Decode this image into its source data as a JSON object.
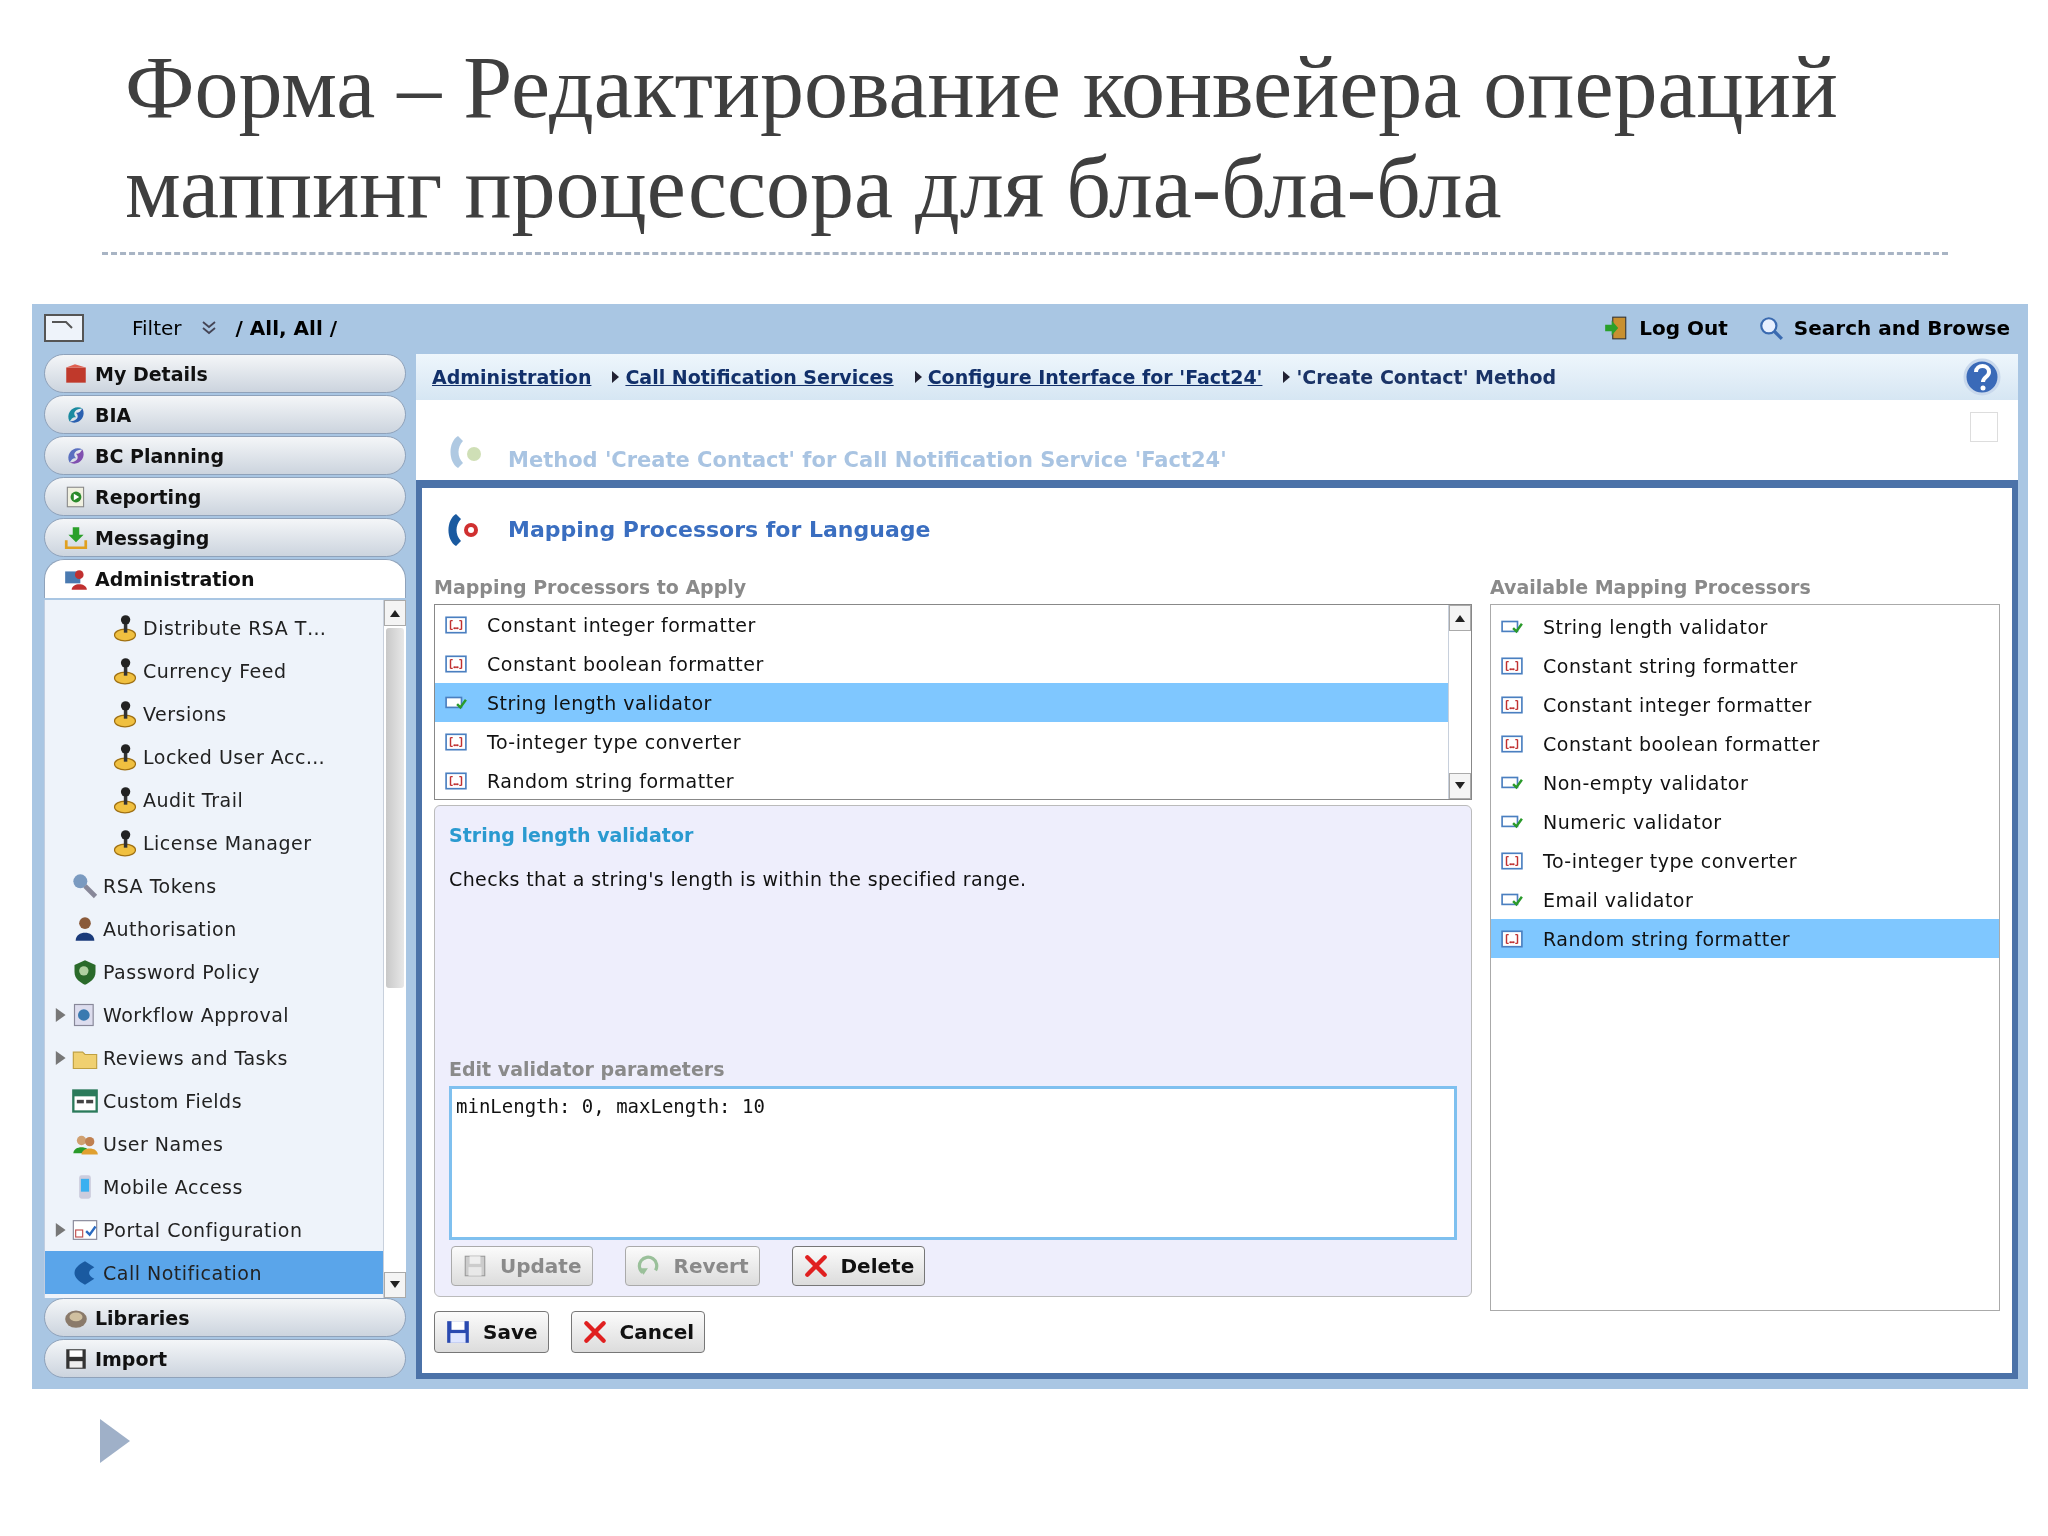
{
  "slide": {
    "title_lines": [
      "Форма – Редактирование конвейера операций",
      "маппинг процессора для бла-бла-бла"
    ]
  },
  "top_bar": {
    "filter_label": "Filter",
    "filter_value": "/ All, All /",
    "actions": [
      {
        "label": "Log Out",
        "kind": "logout"
      },
      {
        "label": "Search and Browse",
        "kind": "search"
      }
    ]
  },
  "sidebar": {
    "sections_before": [
      {
        "label": "My Details"
      },
      {
        "label": "BIA"
      },
      {
        "label": "BC Planning"
      },
      {
        "label": "Reporting"
      },
      {
        "label": "Messaging"
      }
    ],
    "open_section": {
      "label": "Administration",
      "tree": [
        {
          "children": [
            {
              "label": "Distribute RSA T…",
              "collapsed": false,
              "selected": false
            },
            {
              "label": "Currency Feed",
              "collapsed": false,
              "selected": false
            },
            {
              "label": "Versions",
              "collapsed": false,
              "selected": false
            },
            {
              "label": "Locked User Acc…",
              "collapsed": false,
              "selected": false
            },
            {
              "label": "Audit Trail",
              "collapsed": false,
              "selected": false
            },
            {
              "label": "License Manager",
              "collapsed": false,
              "selected": false
            }
          ]
        },
        {
          "label": "RSA Tokens",
          "collapsed": false,
          "selected": false
        },
        {
          "label": "Authorisation",
          "collapsed": false,
          "selected": false
        },
        {
          "label": "Password Policy",
          "collapsed": false,
          "selected": false
        },
        {
          "label": "Workflow Approval",
          "collapsed": true,
          "selected": false
        },
        {
          "label": "Reviews and Tasks",
          "collapsed": true,
          "selected": false
        },
        {
          "label": "Custom Fields",
          "collapsed": false,
          "selected": false
        },
        {
          "label": "User Names",
          "collapsed": false,
          "selected": false
        },
        {
          "label": "Mobile Access",
          "collapsed": false,
          "selected": false
        },
        {
          "label": "Portal Configuration",
          "collapsed": true,
          "selected": false
        },
        {
          "label": "Call Notification",
          "collapsed": false,
          "selected": true
        }
      ]
    },
    "sections_after": [
      {
        "label": "Libraries"
      },
      {
        "label": "Import"
      }
    ]
  },
  "breadcrumb": [
    {
      "label": "Administration",
      "link": true
    },
    {
      "label": "Call Notification Services",
      "link": true
    },
    {
      "label": "Configure Interface for 'Fact24'",
      "link": true
    },
    {
      "label": "'Create Contact' Method",
      "link": false
    }
  ],
  "method_title": "Method 'Create Contact' for Call Notification Service 'Fact24'",
  "panel": {
    "title": "Mapping Processors for Language",
    "applied": {
      "label": "Mapping Processors to Apply",
      "items": [
        {
          "label": "Constant integer formatter",
          "kind": "formatter",
          "selected": false
        },
        {
          "label": "Constant boolean formatter",
          "kind": "formatter",
          "selected": false
        },
        {
          "label": "String length validator",
          "kind": "validator",
          "selected": true
        },
        {
          "label": "To-integer type converter",
          "kind": "formatter",
          "selected": false
        },
        {
          "label": "Random string formatter",
          "kind": "formatter",
          "selected": false
        }
      ]
    },
    "details": {
      "title": "String length validator",
      "description": "Checks that a string's length is within the specified range.",
      "params_label": "Edit validator parameters",
      "params_value": "minLength: 0, maxLength: 10",
      "buttons": [
        {
          "label": "Update",
          "kind": "update",
          "disabled": true
        },
        {
          "label": "Revert",
          "kind": "revert",
          "disabled": true
        },
        {
          "label": "Delete",
          "kind": "delete",
          "disabled": false
        }
      ]
    },
    "actions": [
      {
        "label": "Save",
        "kind": "save"
      },
      {
        "label": "Cancel",
        "kind": "cancel"
      }
    ],
    "available": {
      "label": "Available Mapping Processors",
      "items": [
        {
          "label": "String length validator",
          "kind": "validator",
          "selected": false
        },
        {
          "label": "Constant string formatter",
          "kind": "formatter",
          "selected": false
        },
        {
          "label": "Constant integer formatter",
          "kind": "formatter",
          "selected": false
        },
        {
          "label": "Constant boolean formatter",
          "kind": "formatter",
          "selected": false
        },
        {
          "label": "Non-empty validator",
          "kind": "validator",
          "selected": false
        },
        {
          "label": "Numeric validator",
          "kind": "validator",
          "selected": false
        },
        {
          "label": "To-integer type converter",
          "kind": "formatter",
          "selected": false
        },
        {
          "label": "Email validator",
          "kind": "validator",
          "selected": false
        },
        {
          "label": "Random string formatter",
          "kind": "formatter",
          "selected": true
        }
      ]
    }
  }
}
